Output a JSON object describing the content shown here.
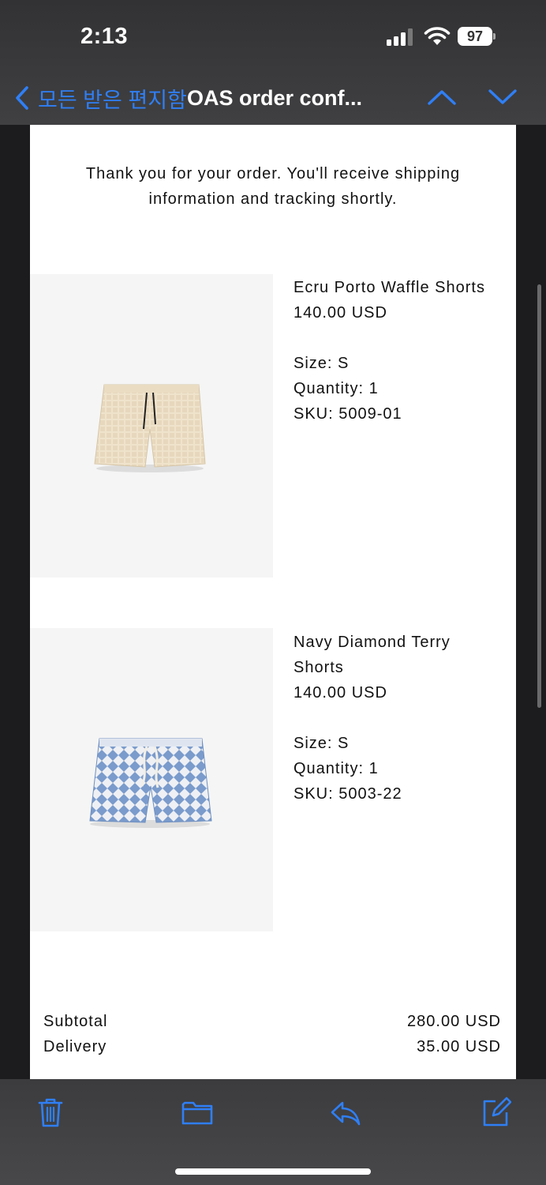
{
  "status_bar": {
    "time": "2:13",
    "battery": "97"
  },
  "nav": {
    "back_label": "모든 받은 편지함",
    "title": "OAS order conf...",
    "accent_color": "#2f7ff6"
  },
  "email": {
    "thanks_line1": "Thank you for your order. You'll receive shipping",
    "thanks_line2": "information and tracking shortly.",
    "products": [
      {
        "name_line1": "Ecru Porto Waffle Shorts",
        "name_line2": "",
        "price": "140.00 USD",
        "size": "Size: S",
        "quantity": "Quantity: 1",
        "sku": "SKU: 5009-01",
        "image": "ecru-waffle-shorts"
      },
      {
        "name_line1": "Navy Diamond Terry",
        "name_line2": "Shorts",
        "price": "140.00 USD",
        "size": "Size: S",
        "quantity": "Quantity: 1",
        "sku": "SKU: 5003-22",
        "image": "navy-diamond-shorts"
      }
    ],
    "summary": {
      "subtotal_label": "Subtotal",
      "subtotal_value": "280.00 USD",
      "delivery_label": "Delivery",
      "delivery_value": "35.00 USD"
    }
  },
  "toolbar": {
    "icons": [
      "trash-icon",
      "folder-icon",
      "reply-icon",
      "compose-icon"
    ]
  }
}
